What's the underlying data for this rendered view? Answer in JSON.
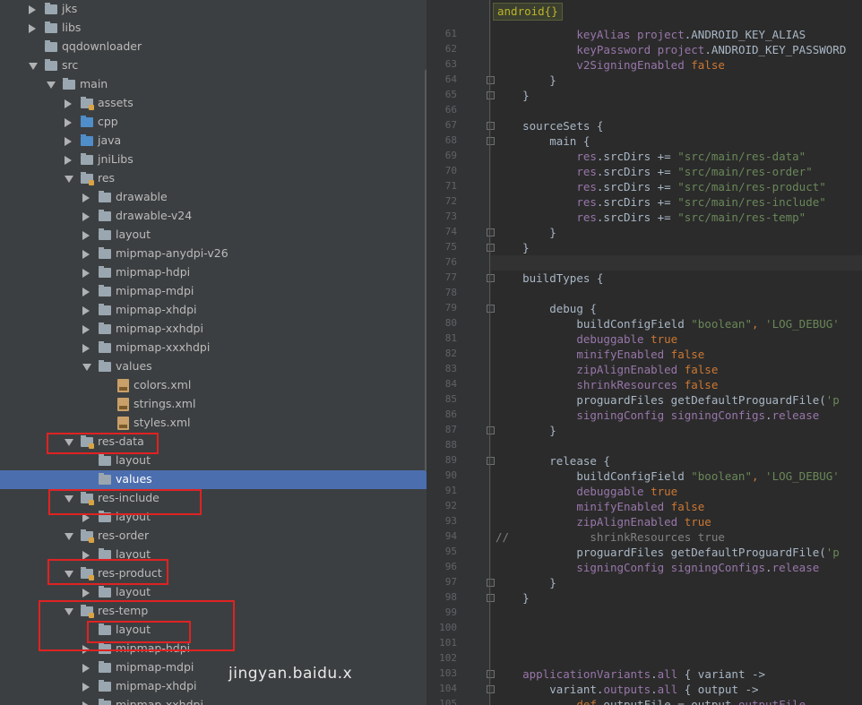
{
  "tree": {
    "items": [
      {
        "label": "jks",
        "depth": 1,
        "arrow": "closed",
        "icon": "folder"
      },
      {
        "label": "libs",
        "depth": 1,
        "arrow": "closed",
        "icon": "folder"
      },
      {
        "label": "qqdownloader",
        "depth": 1,
        "arrow": "none",
        "icon": "folder"
      },
      {
        "label": "src",
        "depth": 1,
        "arrow": "open",
        "icon": "folder"
      },
      {
        "label": "main",
        "depth": 2,
        "arrow": "open",
        "icon": "folder"
      },
      {
        "label": "assets",
        "depth": 3,
        "arrow": "closed",
        "icon": "res-folder"
      },
      {
        "label": "cpp",
        "depth": 3,
        "arrow": "closed",
        "icon": "source-folder"
      },
      {
        "label": "java",
        "depth": 3,
        "arrow": "closed",
        "icon": "source-folder"
      },
      {
        "label": "jniLibs",
        "depth": 3,
        "arrow": "closed",
        "icon": "folder"
      },
      {
        "label": "res",
        "depth": 3,
        "arrow": "open",
        "icon": "res-folder"
      },
      {
        "label": "drawable",
        "depth": 4,
        "arrow": "closed",
        "icon": "folder"
      },
      {
        "label": "drawable-v24",
        "depth": 4,
        "arrow": "closed",
        "icon": "folder"
      },
      {
        "label": "layout",
        "depth": 4,
        "arrow": "closed",
        "icon": "folder"
      },
      {
        "label": "mipmap-anydpi-v26",
        "depth": 4,
        "arrow": "closed",
        "icon": "folder"
      },
      {
        "label": "mipmap-hdpi",
        "depth": 4,
        "arrow": "closed",
        "icon": "folder"
      },
      {
        "label": "mipmap-mdpi",
        "depth": 4,
        "arrow": "closed",
        "icon": "folder"
      },
      {
        "label": "mipmap-xhdpi",
        "depth": 4,
        "arrow": "closed",
        "icon": "folder"
      },
      {
        "label": "mipmap-xxhdpi",
        "depth": 4,
        "arrow": "closed",
        "icon": "folder"
      },
      {
        "label": "mipmap-xxxhdpi",
        "depth": 4,
        "arrow": "closed",
        "icon": "folder"
      },
      {
        "label": "values",
        "depth": 4,
        "arrow": "open",
        "icon": "folder"
      },
      {
        "label": "colors.xml",
        "depth": 5,
        "arrow": "none",
        "icon": "xml-file"
      },
      {
        "label": "strings.xml",
        "depth": 5,
        "arrow": "none",
        "icon": "xml-file"
      },
      {
        "label": "styles.xml",
        "depth": 5,
        "arrow": "none",
        "icon": "xml-file"
      },
      {
        "label": "res-data",
        "depth": 3,
        "arrow": "open",
        "icon": "res-folder"
      },
      {
        "label": "layout",
        "depth": 4,
        "arrow": "none",
        "icon": "folder"
      },
      {
        "label": "values",
        "depth": 4,
        "arrow": "none",
        "icon": "folder",
        "selected": true
      },
      {
        "label": "res-include",
        "depth": 3,
        "arrow": "open",
        "icon": "res-folder"
      },
      {
        "label": "layout",
        "depth": 4,
        "arrow": "closed",
        "icon": "folder"
      },
      {
        "label": "res-order",
        "depth": 3,
        "arrow": "open",
        "icon": "res-folder"
      },
      {
        "label": "layout",
        "depth": 4,
        "arrow": "closed",
        "icon": "folder"
      },
      {
        "label": "res-product",
        "depth": 3,
        "arrow": "open",
        "icon": "res-folder"
      },
      {
        "label": "layout",
        "depth": 4,
        "arrow": "closed",
        "icon": "folder"
      },
      {
        "label": "res-temp",
        "depth": 3,
        "arrow": "open",
        "icon": "res-folder"
      },
      {
        "label": "layout",
        "depth": 4,
        "arrow": "none",
        "icon": "folder"
      },
      {
        "label": "mipmap-hdpi",
        "depth": 4,
        "arrow": "closed",
        "icon": "folder"
      },
      {
        "label": "mipmap-mdpi",
        "depth": 4,
        "arrow": "closed",
        "icon": "folder"
      },
      {
        "label": "mipmap-xhdpi",
        "depth": 4,
        "arrow": "closed",
        "icon": "folder"
      },
      {
        "label": "mipmap-xxhdpi",
        "depth": 4,
        "arrow": "closed",
        "icon": "folder"
      }
    ]
  },
  "editor": {
    "breadcrumb": "android{}",
    "lines": [
      {
        "n": "61",
        "indent": 3,
        "tokens": [
          [
            "p",
            "keyAlias "
          ],
          [
            "p",
            "project"
          ],
          [
            "",
            "."
          ],
          [
            "",
            "ANDROID_KEY_ALIAS"
          ]
        ]
      },
      {
        "n": "62",
        "indent": 3,
        "tokens": [
          [
            "p",
            "keyPassword "
          ],
          [
            "p",
            "project"
          ],
          [
            "",
            "."
          ],
          [
            "",
            "ANDROID_KEY_PASSWORD"
          ]
        ]
      },
      {
        "n": "63",
        "indent": 3,
        "tokens": [
          [
            "p",
            "v2SigningEnabled "
          ],
          [
            "k",
            "false"
          ]
        ]
      },
      {
        "n": "64",
        "indent": 2,
        "tokens": [
          [
            "",
            "}"
          ]
        ]
      },
      {
        "n": "65",
        "indent": 1,
        "tokens": [
          [
            "",
            "}"
          ]
        ]
      },
      {
        "n": "66",
        "indent": 0,
        "tokens": []
      },
      {
        "n": "67",
        "indent": 1,
        "tokens": [
          [
            "",
            "sourceSets {"
          ]
        ]
      },
      {
        "n": "68",
        "indent": 2,
        "tokens": [
          [
            "",
            "main {"
          ]
        ]
      },
      {
        "n": "69",
        "indent": 3,
        "tokens": [
          [
            "p",
            "res"
          ],
          [
            "",
            "."
          ],
          [
            "",
            "srcDirs += "
          ],
          [
            "s",
            "\"src/main/res-data\""
          ]
        ]
      },
      {
        "n": "70",
        "indent": 3,
        "tokens": [
          [
            "p",
            "res"
          ],
          [
            "",
            "."
          ],
          [
            "",
            "srcDirs += "
          ],
          [
            "s",
            "\"src/main/res-order\""
          ]
        ]
      },
      {
        "n": "71",
        "indent": 3,
        "tokens": [
          [
            "p",
            "res"
          ],
          [
            "",
            "."
          ],
          [
            "",
            "srcDirs += "
          ],
          [
            "s",
            "\"src/main/res-product\""
          ]
        ]
      },
      {
        "n": "72",
        "indent": 3,
        "tokens": [
          [
            "p",
            "res"
          ],
          [
            "",
            "."
          ],
          [
            "",
            "srcDirs += "
          ],
          [
            "s",
            "\"src/main/res-include\""
          ]
        ]
      },
      {
        "n": "73",
        "indent": 3,
        "tokens": [
          [
            "p",
            "res"
          ],
          [
            "",
            "."
          ],
          [
            "",
            "srcDirs += "
          ],
          [
            "s",
            "\"src/main/res-temp\""
          ]
        ]
      },
      {
        "n": "74",
        "indent": 2,
        "tokens": [
          [
            "",
            "}"
          ]
        ]
      },
      {
        "n": "75",
        "indent": 1,
        "tokens": [
          [
            "",
            "}"
          ]
        ]
      },
      {
        "n": "76",
        "indent": 0,
        "tokens": [],
        "current": true
      },
      {
        "n": "77",
        "indent": 1,
        "tokens": [
          [
            "",
            "buildTypes {"
          ]
        ]
      },
      {
        "n": "78",
        "indent": 0,
        "tokens": []
      },
      {
        "n": "79",
        "indent": 2,
        "tokens": [
          [
            "",
            "debug {"
          ]
        ]
      },
      {
        "n": "80",
        "indent": 3,
        "tokens": [
          [
            "",
            "buildConfigField "
          ],
          [
            "s",
            "\"boolean\""
          ],
          [
            "k",
            ", "
          ],
          [
            "s",
            "'LOG_DEBUG'"
          ]
        ]
      },
      {
        "n": "81",
        "indent": 3,
        "tokens": [
          [
            "p",
            "debuggable "
          ],
          [
            "k",
            "true"
          ]
        ]
      },
      {
        "n": "82",
        "indent": 3,
        "tokens": [
          [
            "p",
            "minifyEnabled "
          ],
          [
            "k",
            "false"
          ]
        ]
      },
      {
        "n": "83",
        "indent": 3,
        "tokens": [
          [
            "p",
            "zipAlignEnabled "
          ],
          [
            "k",
            "false"
          ]
        ]
      },
      {
        "n": "84",
        "indent": 3,
        "tokens": [
          [
            "p",
            "shrinkResources "
          ],
          [
            "k",
            "false"
          ]
        ]
      },
      {
        "n": "85",
        "indent": 3,
        "tokens": [
          [
            "",
            "proguardFiles getDefaultProguardFile("
          ],
          [
            "s",
            "'p"
          ]
        ]
      },
      {
        "n": "86",
        "indent": 3,
        "tokens": [
          [
            "p",
            "signingConfig "
          ],
          [
            "p",
            "signingConfigs"
          ],
          [
            "",
            "."
          ],
          [
            "p",
            "release"
          ]
        ]
      },
      {
        "n": "87",
        "indent": 2,
        "tokens": [
          [
            "",
            "}"
          ]
        ]
      },
      {
        "n": "88",
        "indent": 0,
        "tokens": []
      },
      {
        "n": "89",
        "indent": 2,
        "tokens": [
          [
            "",
            "release {"
          ]
        ]
      },
      {
        "n": "90",
        "indent": 3,
        "tokens": [
          [
            "",
            "buildConfigField "
          ],
          [
            "s",
            "\"boolean\""
          ],
          [
            "k",
            ", "
          ],
          [
            "s",
            "'LOG_DEBUG'"
          ]
        ]
      },
      {
        "n": "91",
        "indent": 3,
        "tokens": [
          [
            "p",
            "debuggable "
          ],
          [
            "k",
            "true"
          ]
        ]
      },
      {
        "n": "92",
        "indent": 3,
        "tokens": [
          [
            "p",
            "minifyEnabled "
          ],
          [
            "k",
            "false"
          ]
        ]
      },
      {
        "n": "93",
        "indent": 3,
        "tokens": [
          [
            "p",
            "zipAlignEnabled "
          ],
          [
            "k",
            "true"
          ]
        ]
      },
      {
        "n": "94",
        "indent": 0,
        "tokens": [
          [
            "c",
            "//            shrinkResources true"
          ]
        ]
      },
      {
        "n": "95",
        "indent": 3,
        "tokens": [
          [
            "",
            "proguardFiles getDefaultProguardFile("
          ],
          [
            "s",
            "'p"
          ]
        ]
      },
      {
        "n": "96",
        "indent": 3,
        "tokens": [
          [
            "p",
            "signingConfig "
          ],
          [
            "p",
            "signingConfigs"
          ],
          [
            "",
            "."
          ],
          [
            "p",
            "release"
          ]
        ]
      },
      {
        "n": "97",
        "indent": 2,
        "tokens": [
          [
            "",
            "}"
          ]
        ]
      },
      {
        "n": "98",
        "indent": 1,
        "tokens": [
          [
            "",
            "}"
          ]
        ]
      },
      {
        "n": "99",
        "indent": 0,
        "tokens": []
      },
      {
        "n": "100",
        "indent": 0,
        "tokens": []
      },
      {
        "n": "101",
        "indent": 0,
        "tokens": []
      },
      {
        "n": "102",
        "indent": 0,
        "tokens": []
      },
      {
        "n": "103",
        "indent": 1,
        "tokens": [
          [
            "p",
            "applicationVariants"
          ],
          [
            "",
            "."
          ],
          [
            "p",
            "all"
          ],
          [
            "",
            " { variant ->"
          ]
        ]
      },
      {
        "n": "104",
        "indent": 2,
        "tokens": [
          [
            "",
            "variant."
          ],
          [
            "p",
            "outputs"
          ],
          [
            "",
            "."
          ],
          [
            "p",
            "all"
          ],
          [
            "",
            " { output ->"
          ]
        ]
      },
      {
        "n": "105",
        "indent": 3,
        "tokens": [
          [
            "k",
            "def "
          ],
          [
            "",
            "outputFile = output."
          ],
          [
            "p",
            "outputFile"
          ]
        ]
      }
    ]
  },
  "watermark": "jingyan.baidu.x",
  "colors": {
    "tree_bg": "#3c3f41",
    "selection": "#4b6eaf",
    "highlight_box": "#e02222",
    "editor_bg": "#2b2b2b",
    "keyword": "#cc7832",
    "string": "#6a8759",
    "property": "#9876aa"
  }
}
